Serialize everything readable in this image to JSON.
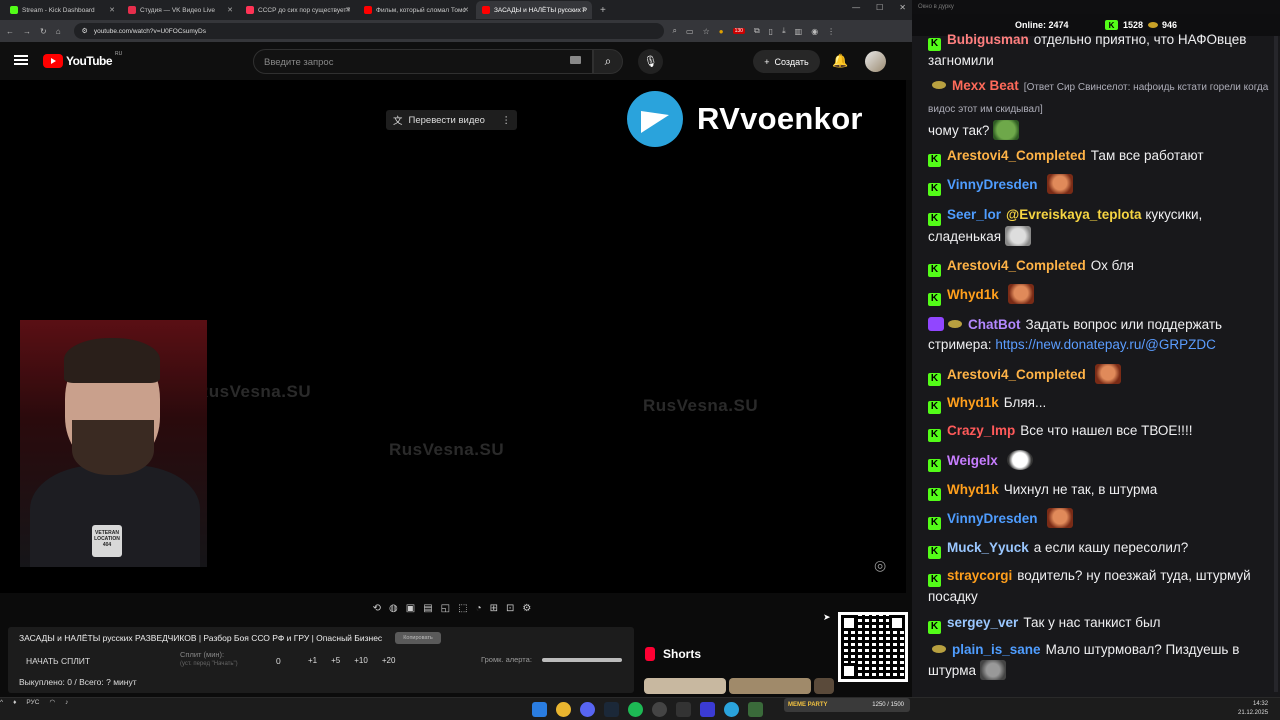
{
  "browser": {
    "tabs": [
      {
        "label": "Stream - Kick Dashboard",
        "favicon_color": "#53fc18",
        "active": false
      },
      {
        "label": "Студия — VK Видео Live",
        "favicon_color": "#e62e4c",
        "active": false
      },
      {
        "label": "СССР до сих пор существует?",
        "favicon_color": "#ff3355",
        "active": false
      },
      {
        "label": "Фильм, который сломал Томс",
        "favicon_color": "#ff0000",
        "active": false
      },
      {
        "label": "ЗАСАДЫ и НАЛЁТЫ русских Р",
        "favicon_color": "#ff0000",
        "active": true
      }
    ],
    "url": "youtube.com/watch?v=U0FOCsumyDs",
    "ext_badge": "130"
  },
  "youtube": {
    "logo_text": "YouTube",
    "region": "RU",
    "search_placeholder": "Введите запрос",
    "create_label": "Создать",
    "translate_label": "Перевести видео",
    "overlay_channel": "RVvoenkor",
    "watermarks": [
      "RusVesna.SU",
      "RusVesna.SU",
      "RusVesna.SU"
    ],
    "webcam_patch": "VETERAN LOCATION 404"
  },
  "panel": {
    "title": "ЗАСАДЫ и НАЛЁТЫ русских РАЗВЕДЧИКОВ | Разбор Боя ССО РФ и ГРУ | Опасный Бизнес",
    "badge": "Копировать",
    "start_split": "НАЧАТЬ СПЛИТ",
    "split_label": "Сплит (мин):",
    "split_sub": "(уст. перед \"Начать\")",
    "split_value": "0",
    "increments": [
      "+1",
      "+5",
      "+10",
      "+20"
    ],
    "volume_label": "Громк. алерта:",
    "bought": "Выкуплено: 0 / Всего: ? минут",
    "shorts_label": "Shorts"
  },
  "chat": {
    "window_title": "Окно в дурку",
    "online_label": "Online:",
    "online_count": "2474",
    "k_count": "1528",
    "coin_count": "946",
    "messages": [
      {
        "user": "Bubigusman",
        "color": "#ff7f7f",
        "badge": "k",
        "text": "отдельно приятно, что НАФОвцев загномили"
      },
      {
        "user": "Mexx Beat",
        "color": "#ff6a5a",
        "badge": "crown",
        "reply": "[Ответ Сир Свинселот: нафоидь кстати горели когда видос этот им скидывал]",
        "text": "чому так?"
      },
      {
        "user": "Arestovi4_Completed",
        "color": "#ffb347",
        "badge": "k",
        "text": "Там все работают"
      },
      {
        "user": "VinnyDresden",
        "color": "#4f9dff",
        "badge": "k",
        "text": ""
      },
      {
        "user": "Seer_lor",
        "color": "#4f9dff",
        "badge": "k",
        "mention": "@Evreiskaya_teplota",
        "text": "кукусики, сладенькая"
      },
      {
        "user": "Arestovi4_Completed",
        "color": "#ffb347",
        "badge": "k",
        "text": "Ох бля"
      },
      {
        "user": "Whyd1k",
        "color": "#ff9f1c",
        "badge": "k",
        "text": ""
      },
      {
        "user": "ChatBot",
        "color": "#b388ff",
        "badge": "bot",
        "text": "Задать вопрос или поддержать стримера:",
        "link": "https://new.donatepay.ru/@GRPZDC"
      },
      {
        "user": "Arestovi4_Completed",
        "color": "#ffb347",
        "badge": "k",
        "text": ""
      },
      {
        "user": "Whyd1k",
        "color": "#ff9f1c",
        "badge": "k",
        "text": "Бляя..."
      },
      {
        "user": "Crazy_Imp",
        "color": "#ff5a5a",
        "badge": "k",
        "text": "Все что нашел все ТВОЕ!!!!"
      },
      {
        "user": "Weigelx",
        "color": "#c77dff",
        "badge": "k",
        "text": ""
      },
      {
        "user": "Whyd1k",
        "color": "#ff9f1c",
        "badge": "k",
        "text": "Чихнул не так, в штурма"
      },
      {
        "user": "VinnyDresden",
        "color": "#4f9dff",
        "badge": "k",
        "text": ""
      },
      {
        "user": "Muck_Yyuck",
        "color": "#9ac7ff",
        "badge": "k",
        "text": "а если кашу пересолил?"
      },
      {
        "user": "straycorgi",
        "color": "#ff9f1c",
        "badge": "k",
        "text": "водитель? ну поезжай туда, штурмуй посадку"
      },
      {
        "user": "sergey_ver",
        "color": "#9ac7ff",
        "badge": "k",
        "text": "Так у нас танкист был"
      },
      {
        "user": "plain_is_sane",
        "color": "#4f9dff",
        "badge": "crown",
        "text": "Мало штурмовал? Пиздуешь в штурма"
      }
    ]
  },
  "taskbar": {
    "lang": "РУС",
    "time": "14:32",
    "date": "21.12.2025",
    "widget_label": "MEME PARTY",
    "widget_value": "1250 / 1500"
  }
}
